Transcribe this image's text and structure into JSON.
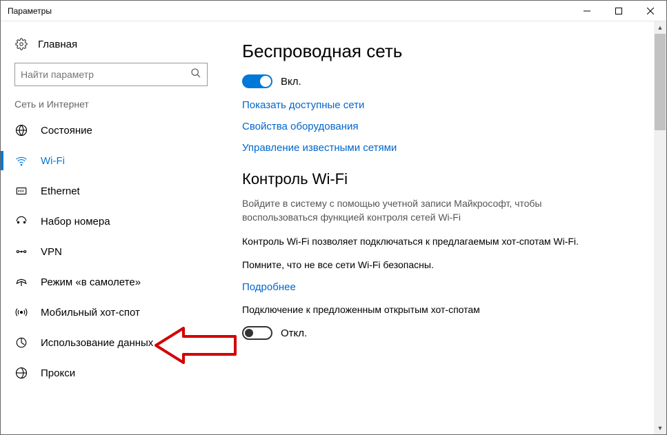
{
  "window": {
    "title": "Параметры"
  },
  "sidebar": {
    "home": "Главная",
    "search_placeholder": "Найти параметр",
    "category": "Сеть и Интернет",
    "items": [
      {
        "label": "Состояние"
      },
      {
        "label": "Wi-Fi"
      },
      {
        "label": "Ethernet"
      },
      {
        "label": "Набор номера"
      },
      {
        "label": "VPN"
      },
      {
        "label": "Режим «в самолете»"
      },
      {
        "label": "Мобильный хот-спот"
      },
      {
        "label": "Использование данных"
      },
      {
        "label": "Прокси"
      }
    ]
  },
  "main": {
    "heading1": "Беспроводная сеть",
    "toggle1_state": "Вкл.",
    "link1": "Показать доступные сети",
    "link2": "Свойства оборудования",
    "link3": "Управление известными сетями",
    "heading2": "Контроль Wi-Fi",
    "para1": "Войдите в систему с помощью учетной записи Майкрософт, чтобы воспользоваться функцией контроля сетей Wi-Fi",
    "para2": "Контроль Wi-Fi позволяет подключаться к предлагаемым хот-спотам Wi-Fi.",
    "para3": "Помните, что не все сети Wi-Fi безопасны.",
    "link4": "Подробнее",
    "para4": "Подключение к предложенным открытым хот-спотам",
    "toggle2_state": "Откл."
  }
}
